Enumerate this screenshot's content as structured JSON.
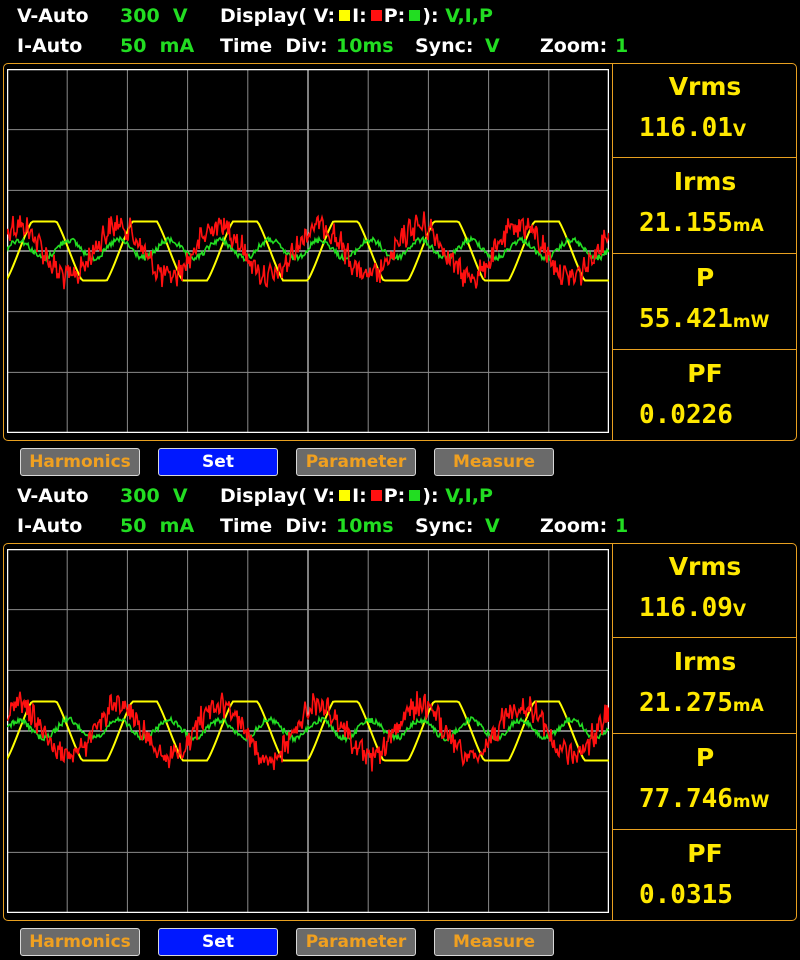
{
  "colors": {
    "voltage": "#ffff00",
    "current": "#ff1010",
    "power": "#22dd22",
    "accent": "#e8a020",
    "grid": "#8a8a8a"
  },
  "header": {
    "v_range_label": "V-Auto",
    "v_range_value": "300  V",
    "display_label": "Display( V:",
    "display_i": "I:",
    "display_p": "P:",
    "display_close": "):",
    "display_value": "V,I,P",
    "i_range_label": "I-Auto",
    "i_range_value": "50  mA",
    "time_div_label": "Time  Div:",
    "time_div_value": "10ms",
    "sync_label": "Sync:",
    "sync_value": "V",
    "zoom_label": "Zoom:",
    "zoom_value": "1"
  },
  "panels": [
    {
      "readouts": [
        {
          "label": "Vrms",
          "value": "116.01",
          "unit": "V"
        },
        {
          "label": "Irms",
          "value": "21.155",
          "unit": "mA"
        },
        {
          "label": "P",
          "value": "55.421",
          "unit": "mW"
        },
        {
          "label": "PF",
          "value": "0.0226",
          "unit": ""
        }
      ]
    },
    {
      "readouts": [
        {
          "label": "Vrms",
          "value": "116.09",
          "unit": "V"
        },
        {
          "label": "Irms",
          "value": "21.275",
          "unit": "mA"
        },
        {
          "label": "P",
          "value": "77.746",
          "unit": "mW"
        },
        {
          "label": "PF",
          "value": "0.0315",
          "unit": ""
        }
      ]
    }
  ],
  "buttons": [
    "Harmonics",
    "Set",
    "Parameter",
    "Measure"
  ],
  "selected_button": "Set"
}
